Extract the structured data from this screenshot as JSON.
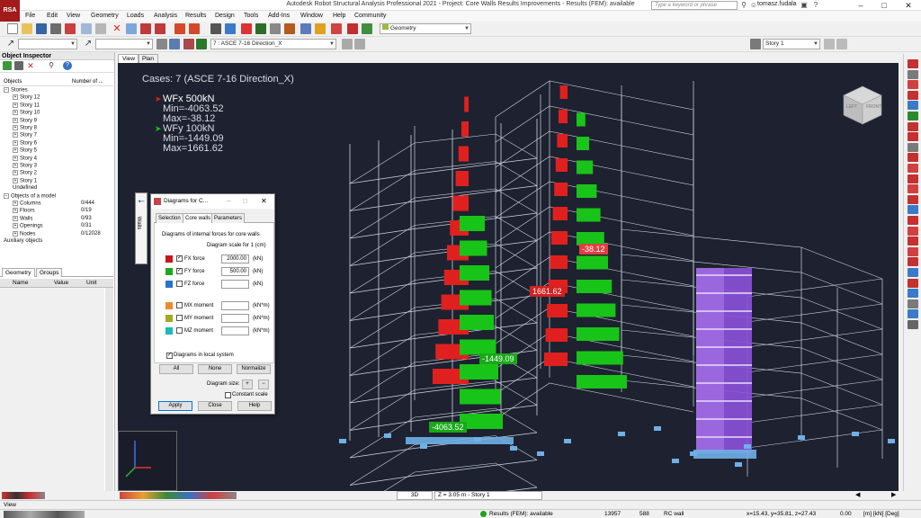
{
  "app": {
    "logo": "RSA",
    "title": "Autodesk Robot Structural Analysis Professional 2021 - Project: Core Walls Results Improvements - Results (FEM): available",
    "search_placeholder": "Type a keyword or phrase",
    "user": "tomasz.fudala"
  },
  "menu": [
    "File",
    "Edit",
    "View",
    "Geometry",
    "Loads",
    "Analysis",
    "Results",
    "Design",
    "Tools",
    "Add-Ins",
    "Window",
    "Help",
    "Community"
  ],
  "toolbar": {
    "case_combo": "7 : ASCE 7-16 Direction_X",
    "layout_combo": "Geometry",
    "story_combo": "Story 1"
  },
  "inspector": {
    "title": "Object Inspector",
    "col_objects": "Objects",
    "col_number": "Number of ...",
    "tree": [
      {
        "label": "Stories",
        "sym": "−",
        "indent": 0,
        "count": ""
      },
      {
        "label": "Story 12",
        "sym": "+",
        "indent": 1,
        "count": ""
      },
      {
        "label": "Story 11",
        "sym": "+",
        "indent": 1,
        "count": ""
      },
      {
        "label": "Story 10",
        "sym": "+",
        "indent": 1,
        "count": ""
      },
      {
        "label": "Story 9",
        "sym": "+",
        "indent": 1,
        "count": ""
      },
      {
        "label": "Story 8",
        "sym": "+",
        "indent": 1,
        "count": ""
      },
      {
        "label": "Story 7",
        "sym": "+",
        "indent": 1,
        "count": ""
      },
      {
        "label": "Story 6",
        "sym": "+",
        "indent": 1,
        "count": ""
      },
      {
        "label": "Story 5",
        "sym": "+",
        "indent": 1,
        "count": ""
      },
      {
        "label": "Story 4",
        "sym": "+",
        "indent": 1,
        "count": ""
      },
      {
        "label": "Story 3",
        "sym": "+",
        "indent": 1,
        "count": ""
      },
      {
        "label": "Story 2",
        "sym": "+",
        "indent": 1,
        "count": ""
      },
      {
        "label": "Story 1",
        "sym": "+",
        "indent": 1,
        "count": ""
      },
      {
        "label": "Undefined",
        "sym": "",
        "indent": 1,
        "count": ""
      },
      {
        "label": "Objects of a model",
        "sym": "−",
        "indent": 0,
        "count": ""
      },
      {
        "label": "Columns",
        "sym": "+",
        "indent": 1,
        "count": "0/444"
      },
      {
        "label": "Floors",
        "sym": "+",
        "indent": 1,
        "count": "0/19"
      },
      {
        "label": "Walls",
        "sym": "+",
        "indent": 1,
        "count": "0/93"
      },
      {
        "label": "Openings",
        "sym": "+",
        "indent": 1,
        "count": "0/31"
      },
      {
        "label": "Nodes",
        "sym": "+",
        "indent": 1,
        "count": "0/12028"
      },
      {
        "label": "Auxiliary objects",
        "sym": "",
        "indent": 0,
        "count": ""
      }
    ],
    "tabs": [
      "Geometry",
      "Groups"
    ],
    "prop_cols": [
      "Name",
      "Value",
      "Unit"
    ]
  },
  "view_tabs": [
    "View",
    "Plan"
  ],
  "viewport": {
    "cases": "Cases: 7 (ASCE 7-16 Direction_X)",
    "fx_label": "WFx  500kN",
    "fx_min": "Min=-4063.52",
    "fx_max": "Max=-38.12",
    "fy_label": "WFy  100kN",
    "fy_min": "Min=-1449.09",
    "fy_max": "Max=1661.62",
    "ann_a": "-38.12",
    "ann_b": "1661.62",
    "ann_c": "-1449.09",
    "ann_d": "-4063.52",
    "cube_left": "LEFT",
    "cube_front": "FRONT",
    "side_tab": "Walls",
    "colors": {
      "red": "#e0201e",
      "green": "#18c418",
      "purple": "#8a50d8",
      "support": "#6fb0e8"
    }
  },
  "dialog": {
    "title": "Diagrams for C...",
    "tabs": [
      "Selection",
      "Core walls",
      "Parameters"
    ],
    "section": "Diagrams of internal forces for core walls",
    "scale_caption": "Diagram scale for 1 (cm)",
    "rows": [
      {
        "label": "FX force",
        "checked": true,
        "value": "2000.00",
        "unit": "(kN)",
        "color": "#c8161d"
      },
      {
        "label": "FY force",
        "checked": true,
        "value": "500.00",
        "unit": "(kN)",
        "color": "#1fa81f"
      },
      {
        "label": "FZ force",
        "checked": false,
        "value": "",
        "unit": "(kN)",
        "color": "#2a73c9"
      },
      {
        "label": "MX moment",
        "checked": false,
        "value": "",
        "unit": "(kN*m)",
        "color": "#f08a2a"
      },
      {
        "label": "MY moment",
        "checked": false,
        "value": "",
        "unit": "(kN*m)",
        "color": "#a3a81a"
      },
      {
        "label": "MZ moment",
        "checked": false,
        "value": "",
        "unit": "(kN*m)",
        "color": "#1ab8b8"
      }
    ],
    "local_label": "Diagrams in local system",
    "btn_all": "All",
    "btn_none": "None",
    "btn_normalize": "Normalize",
    "size_label": "Diagram size:",
    "size_plus": "+",
    "size_minus": "−",
    "constant_scale": "Constant scale",
    "btn_apply": "Apply",
    "btn_close": "Close",
    "btn_help": "Help"
  },
  "bottom": {
    "mode": "3D",
    "z_level": "Z = 3.05 m - Story 1"
  },
  "status": {
    "view": "View",
    "results": "Results (FEM): available",
    "count": "13957",
    "num2": "588",
    "section": "RC wall",
    "coords": "x=15.43, y=35.81, z=27.43",
    "angle": "0.00",
    "units": "[m] [kN] [Deg]"
  }
}
